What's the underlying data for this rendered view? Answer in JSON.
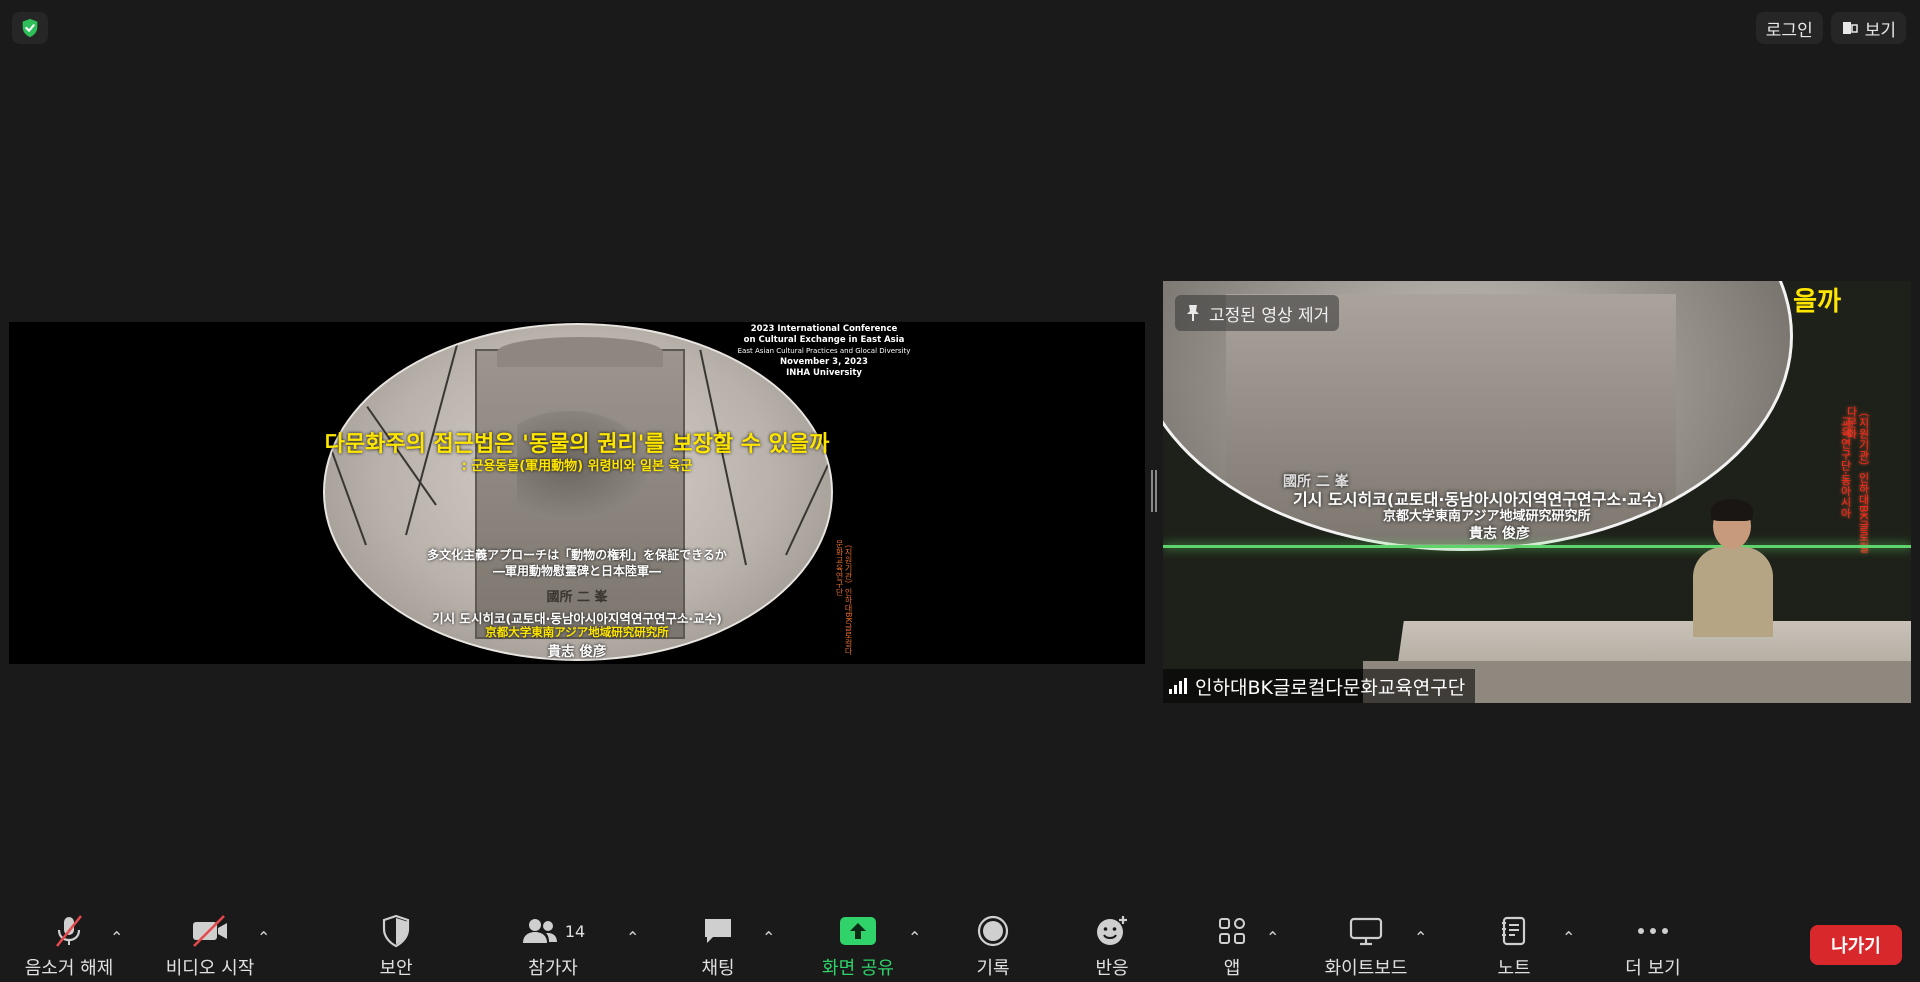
{
  "top": {
    "login_label": "로그인",
    "view_label": "보기"
  },
  "slide": {
    "conference": [
      "2023 International Conference",
      "on Cultural Exchange in East Asia",
      "East Asian Cultural Practices and Glocal Diversity",
      "November 3, 2023",
      "INHA University"
    ],
    "title": "다문화주의 접근법은 '동물의 권리'를 보장할 수 있을까",
    "subtitle": ": 군용동물(軍用動物) 위령비와 일본 육군",
    "jp_title": "多文化主義アプローチは「動物の権利」を保証できるか",
    "jp_subtitle": "―軍用動物慰霊碑と日本陸軍―",
    "author_kr": "기시 도시히코(교토대·동남아시아지역연구연구소·교수)",
    "author_affil": "京都大学東南アジア地域研究研究所",
    "author_jp": "貴志 俊彦",
    "vertical_note": "（지원기관）인하대BK글로컬다문화교육연구단",
    "plaque": "國所 二 峯"
  },
  "video": {
    "unpin_label": "고정된 영상 제거",
    "participant_name": "인하대BK글로컬다문화교육연구단",
    "overlay_title": "을까",
    "overlay_line1": "기시 도시히코(교토대·동남아시아지역연구연구소·교수)",
    "overlay_line2": "京都大学東南アジア地域研究研究所",
    "overlay_line3": "貴志 俊彦",
    "overlay_plaque": "國所 二 峯",
    "red_note1": "（지원기관）인하대BK글로컬다문화",
    "red_note2": "교육연구단·동아시아"
  },
  "toolbar": {
    "mute_label": "음소거 해제",
    "video_label": "비디오 시작",
    "security_label": "보안",
    "participants_label": "참가자",
    "participants_count": "14",
    "chat_label": "채팅",
    "share_label": "화면 공유",
    "record_label": "기록",
    "reactions_label": "반응",
    "apps_label": "앱",
    "whiteboard_label": "화이트보드",
    "notes_label": "노트",
    "more_label": "더 보기",
    "leave_label": "나가기"
  },
  "colors": {
    "background": "#1a1a1a",
    "accent_green": "#2fd36a",
    "leave_red": "#d9282b",
    "slide_yellow": "#ffe600",
    "mute_slash": "#e5484d"
  }
}
